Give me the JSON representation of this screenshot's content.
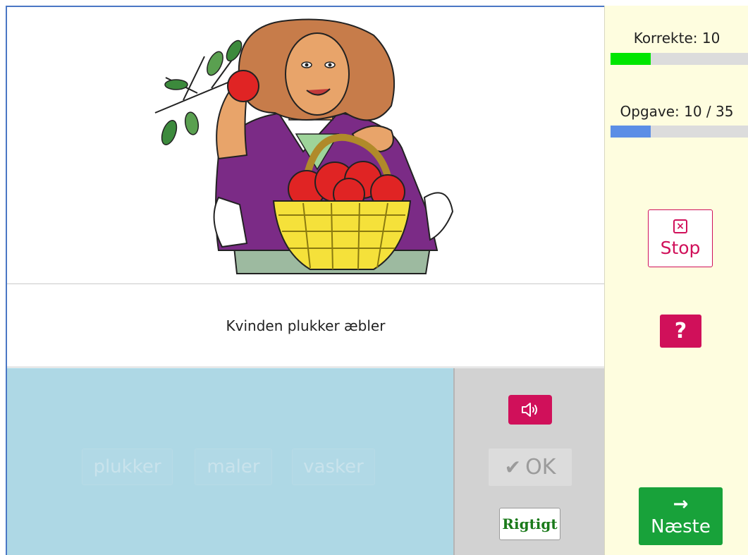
{
  "illustration": {
    "description_icon": "woman-picking-apples-illustration"
  },
  "sentence": {
    "text": "Kvinden plukker æbler"
  },
  "words": [
    "plukker",
    "maler",
    "vasker"
  ],
  "controls": {
    "sound_icon": "speaker-icon",
    "ok_label": "OK",
    "ok_icon": "checkmark-icon",
    "rigtigt_label": "Rigtigt"
  },
  "sidebar": {
    "korrekte_label": "Korrekte: 10",
    "korrekte_progress": 0.29,
    "opgave_label": "Opgave: 10 / 35",
    "opgave_progress": 0.29,
    "stop_label": "Stop",
    "help_label": "?",
    "next_label": "Næste"
  },
  "colors": {
    "accent": "#d0105a",
    "next_green": "#18a23a",
    "korrekte_bar": "#00e600",
    "opgave_bar": "#5b8ee6",
    "sidebar_bg": "#fefddf",
    "word_area_bg": "#aed8e5"
  }
}
